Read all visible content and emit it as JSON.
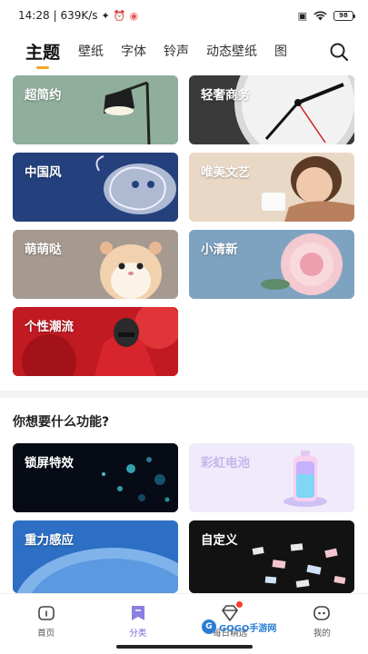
{
  "status_bar": {
    "time": "14:28",
    "speed": "| 639K/s",
    "battery": "98"
  },
  "tabs": [
    {
      "label": "主题",
      "active": true
    },
    {
      "label": "壁纸"
    },
    {
      "label": "字体"
    },
    {
      "label": "铃声"
    },
    {
      "label": "动态壁纸"
    },
    {
      "label": "图"
    }
  ],
  "theme_categories": [
    {
      "label": "超简约",
      "icon": "lamp-image"
    },
    {
      "label": "轻奢商务",
      "icon": "clock-image"
    },
    {
      "label": "中国风",
      "icon": "dragon-image"
    },
    {
      "label": "唯美文艺",
      "icon": "woman-cup-image"
    },
    {
      "label": "萌萌哒",
      "icon": "hamster-image"
    },
    {
      "label": "小清新",
      "icon": "peony-image"
    },
    {
      "label": "个性潮流",
      "icon": "hooded-person-image"
    }
  ],
  "function_section": {
    "title": "你想要什么功能?",
    "items": [
      {
        "label": "锁屏特效"
      },
      {
        "label": "彩虹电池"
      },
      {
        "label": "重力感应"
      },
      {
        "label": "自定义"
      }
    ]
  },
  "bottom_nav": [
    {
      "label": "首页",
      "icon": "home-icon"
    },
    {
      "label": "分类",
      "icon": "category-icon",
      "active": true
    },
    {
      "label": "每日精选",
      "icon": "diamond-icon",
      "badge": true
    },
    {
      "label": "我的",
      "icon": "profile-icon"
    }
  ],
  "watermark": {
    "text": "GOGO手游网"
  },
  "colors": {
    "accent": "#f5a524",
    "nav_active": "#7a6ad8",
    "badge": "#ff3b30"
  }
}
